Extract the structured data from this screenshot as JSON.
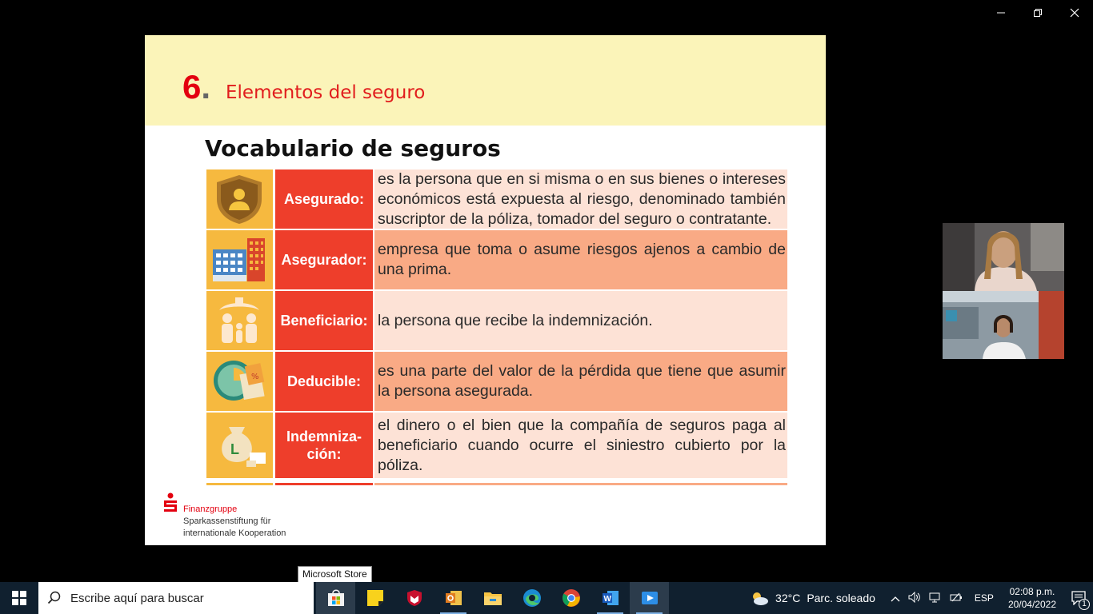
{
  "window": {
    "minimize_icon": "minimize-icon",
    "restore_icon": "restore-icon",
    "close_icon": "close-icon"
  },
  "slide": {
    "number": "6",
    "number_dot": ".",
    "title": "Elementos del seguro",
    "vocab_title": "Vocabulario de seguros",
    "rows": [
      {
        "icon": "shield-person-icon",
        "term": "Asegurado:",
        "definition": "es la persona que en si misma o en sus bienes o intereses económicos está expuesta al riesgo, denominado también suscriptor de la póliza, tomador del seguro o contratante."
      },
      {
        "icon": "office-buildings-icon",
        "term": "Asegurador:",
        "definition": "empresa que toma o asume riesgos ajenos a cambio de una prima."
      },
      {
        "icon": "beneficiary-family-icon",
        "term": "Beneficiario:",
        "definition": "la persona que recibe la indemnización."
      },
      {
        "icon": "clock-document-icon",
        "term": "Deducible:",
        "definition": "es una parte del valor de la pérdida que tiene que asumir la persona asegurada."
      },
      {
        "icon": "money-bag-icon",
        "term_line1": "Indemniza-",
        "term_line2": "ción:",
        "definition": "el dinero o el bien que la compañía de seguros paga al beneficiario cuando ocurre el siniestro cubierto por la póliza."
      }
    ],
    "logo": {
      "brand": "Finanzgruppe",
      "line1": "Sparkassenstiftung für",
      "line2": "internationale Kooperation"
    }
  },
  "video_participants": [
    {
      "name": "participant-1"
    },
    {
      "name": "participant-2"
    }
  ],
  "tooltip": "Microsoft Store",
  "taskbar": {
    "search_placeholder": "Escribe aquí para buscar",
    "apps": [
      "task-view-icon",
      "sticky-notes-icon",
      "mcafee-icon",
      "outlook-icon",
      "file-explorer-icon",
      "edge-icon",
      "chrome-icon",
      "word-icon",
      "video-app-icon"
    ],
    "weather_temp": "32°C",
    "weather_desc": "Parc. soleado",
    "language": "ESP",
    "time": "02:08 p.m.",
    "date": "20/04/2022",
    "notifications": "1"
  },
  "colors": {
    "header_bg": "#fbf4b9",
    "accent_red": "#e3000f",
    "term_bg": "#ee3e2b",
    "icon_bg": "#f6b93f",
    "def_light": "#fde2d6",
    "def_dark": "#f9aa85",
    "taskbar": "#10202f"
  }
}
